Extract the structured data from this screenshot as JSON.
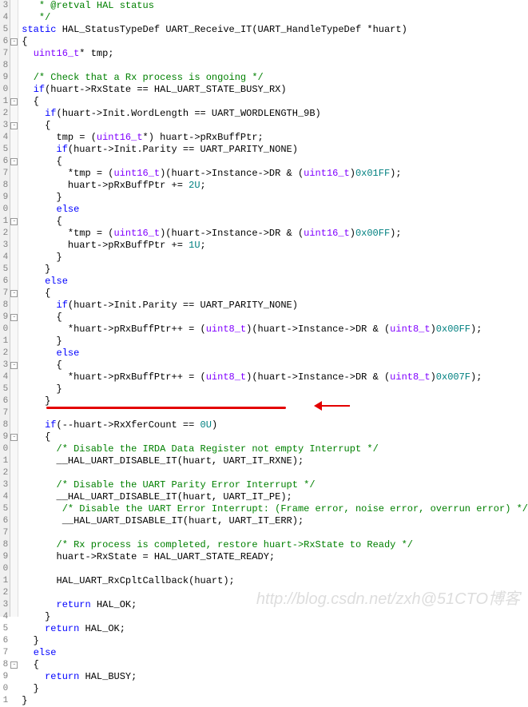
{
  "gutter_start": 3,
  "lines": [
    {
      "code": "   <span class='cmt'>* @retval HAL status</span>",
      "fold": ""
    },
    {
      "code": "   <span class='cmt'>*/</span>",
      "fold": ""
    },
    {
      "code": "<span class='kw'>static</span> HAL_StatusTypeDef UART_Receive_IT(UART_HandleTypeDef *huart)",
      "fold": ""
    },
    {
      "code": "{",
      "fold": "-"
    },
    {
      "code": "  <span class='typ'>uint16_t</span>* tmp;",
      "fold": ""
    },
    {
      "code": "",
      "fold": ""
    },
    {
      "code": "  <span class='cmt'>/* Check that a Rx process is ongoing */</span>",
      "fold": ""
    },
    {
      "code": "  <span class='kw'>if</span>(huart-&gt;RxState == HAL_UART_STATE_BUSY_RX)",
      "fold": ""
    },
    {
      "code": "  {",
      "fold": "-"
    },
    {
      "code": "    <span class='kw'>if</span>(huart-&gt;Init.WordLength == UART_WORDLENGTH_9B)",
      "fold": ""
    },
    {
      "code": "    {",
      "fold": "-"
    },
    {
      "code": "      tmp = (<span class='typ'>uint16_t</span>*) huart-&gt;pRxBuffPtr;",
      "fold": ""
    },
    {
      "code": "      <span class='kw'>if</span>(huart-&gt;Init.Parity == UART_PARITY_NONE)",
      "fold": ""
    },
    {
      "code": "      {",
      "fold": "-"
    },
    {
      "code": "        *tmp = (<span class='typ'>uint16_t</span>)(huart-&gt;Instance-&gt;DR &amp; (<span class='typ'>uint16_t</span>)<span class='num'>0x01FF</span>);",
      "fold": ""
    },
    {
      "code": "        huart-&gt;pRxBuffPtr += <span class='num'>2U</span>;",
      "fold": ""
    },
    {
      "code": "      }",
      "fold": ""
    },
    {
      "code": "      <span class='kw'>else</span>",
      "fold": ""
    },
    {
      "code": "      {",
      "fold": "-"
    },
    {
      "code": "        *tmp = (<span class='typ'>uint16_t</span>)(huart-&gt;Instance-&gt;DR &amp; (<span class='typ'>uint16_t</span>)<span class='num'>0x00FF</span>);",
      "fold": ""
    },
    {
      "code": "        huart-&gt;pRxBuffPtr += <span class='num'>1U</span>;",
      "fold": ""
    },
    {
      "code": "      }",
      "fold": ""
    },
    {
      "code": "    }",
      "fold": ""
    },
    {
      "code": "    <span class='kw'>else</span>",
      "fold": ""
    },
    {
      "code": "    {",
      "fold": "-"
    },
    {
      "code": "      <span class='kw'>if</span>(huart-&gt;Init.Parity == UART_PARITY_NONE)",
      "fold": ""
    },
    {
      "code": "      {",
      "fold": "-"
    },
    {
      "code": "        *huart-&gt;pRxBuffPtr++ = (<span class='typ'>uint8_t</span>)(huart-&gt;Instance-&gt;DR &amp; (<span class='typ'>uint8_t</span>)<span class='num'>0x00FF</span>);",
      "fold": ""
    },
    {
      "code": "      }",
      "fold": ""
    },
    {
      "code": "      <span class='kw'>else</span>",
      "fold": ""
    },
    {
      "code": "      {",
      "fold": "-"
    },
    {
      "code": "        *huart-&gt;pRxBuffPtr++ = (<span class='typ'>uint8_t</span>)(huart-&gt;Instance-&gt;DR &amp; (<span class='typ'>uint8_t</span>)<span class='num'>0x007F</span>);",
      "fold": ""
    },
    {
      "code": "      }",
      "fold": ""
    },
    {
      "code": "    }",
      "fold": ""
    },
    {
      "code": "",
      "fold": ""
    },
    {
      "code": "    <span class='kw'>if</span>(--huart-&gt;RxXferCount == <span class='num'>0U</span>)",
      "fold": ""
    },
    {
      "code": "    {",
      "fold": "-"
    },
    {
      "code": "      <span class='cmt'>/* Disable the IRDA Data Register not empty Interrupt */</span>",
      "fold": ""
    },
    {
      "code": "      __HAL_UART_DISABLE_IT(huart, UART_IT_RXNE);",
      "fold": ""
    },
    {
      "code": "",
      "fold": ""
    },
    {
      "code": "      <span class='cmt'>/* Disable the UART Parity Error Interrupt */</span>",
      "fold": ""
    },
    {
      "code": "      __HAL_UART_DISABLE_IT(huart, UART_IT_PE);",
      "fold": ""
    },
    {
      "code": "       <span class='cmt'>/* Disable the UART Error Interrupt: (Frame error, noise error, overrun error) */</span>",
      "fold": ""
    },
    {
      "code": "       __HAL_UART_DISABLE_IT(huart, UART_IT_ERR);",
      "fold": ""
    },
    {
      "code": "",
      "fold": ""
    },
    {
      "code": "      <span class='cmt'>/* Rx process is completed, restore huart-&gt;RxState to Ready */</span>",
      "fold": ""
    },
    {
      "code": "      huart-&gt;RxState = HAL_UART_STATE_READY;",
      "fold": ""
    },
    {
      "code": "",
      "fold": ""
    },
    {
      "code": "      HAL_UART_RxCpltCallback(huart);",
      "fold": ""
    },
    {
      "code": "",
      "fold": ""
    },
    {
      "code": "      <span class='kw'>return</span> HAL_OK;",
      "fold": ""
    },
    {
      "code": "    }",
      "fold": ""
    },
    {
      "code": "    <span class='kw'>return</span> HAL_OK;",
      "fold": ""
    },
    {
      "code": "  }",
      "fold": ""
    },
    {
      "code": "  <span class='kw'>else</span>",
      "fold": ""
    },
    {
      "code": "  {",
      "fold": "-"
    },
    {
      "code": "    <span class='kw'>return</span> HAL_BUSY;",
      "fold": ""
    },
    {
      "code": "  }",
      "fold": ""
    },
    {
      "code": "}",
      "fold": ""
    }
  ],
  "watermark": "http://blog.csdn.net/zxh@51CTO博客"
}
